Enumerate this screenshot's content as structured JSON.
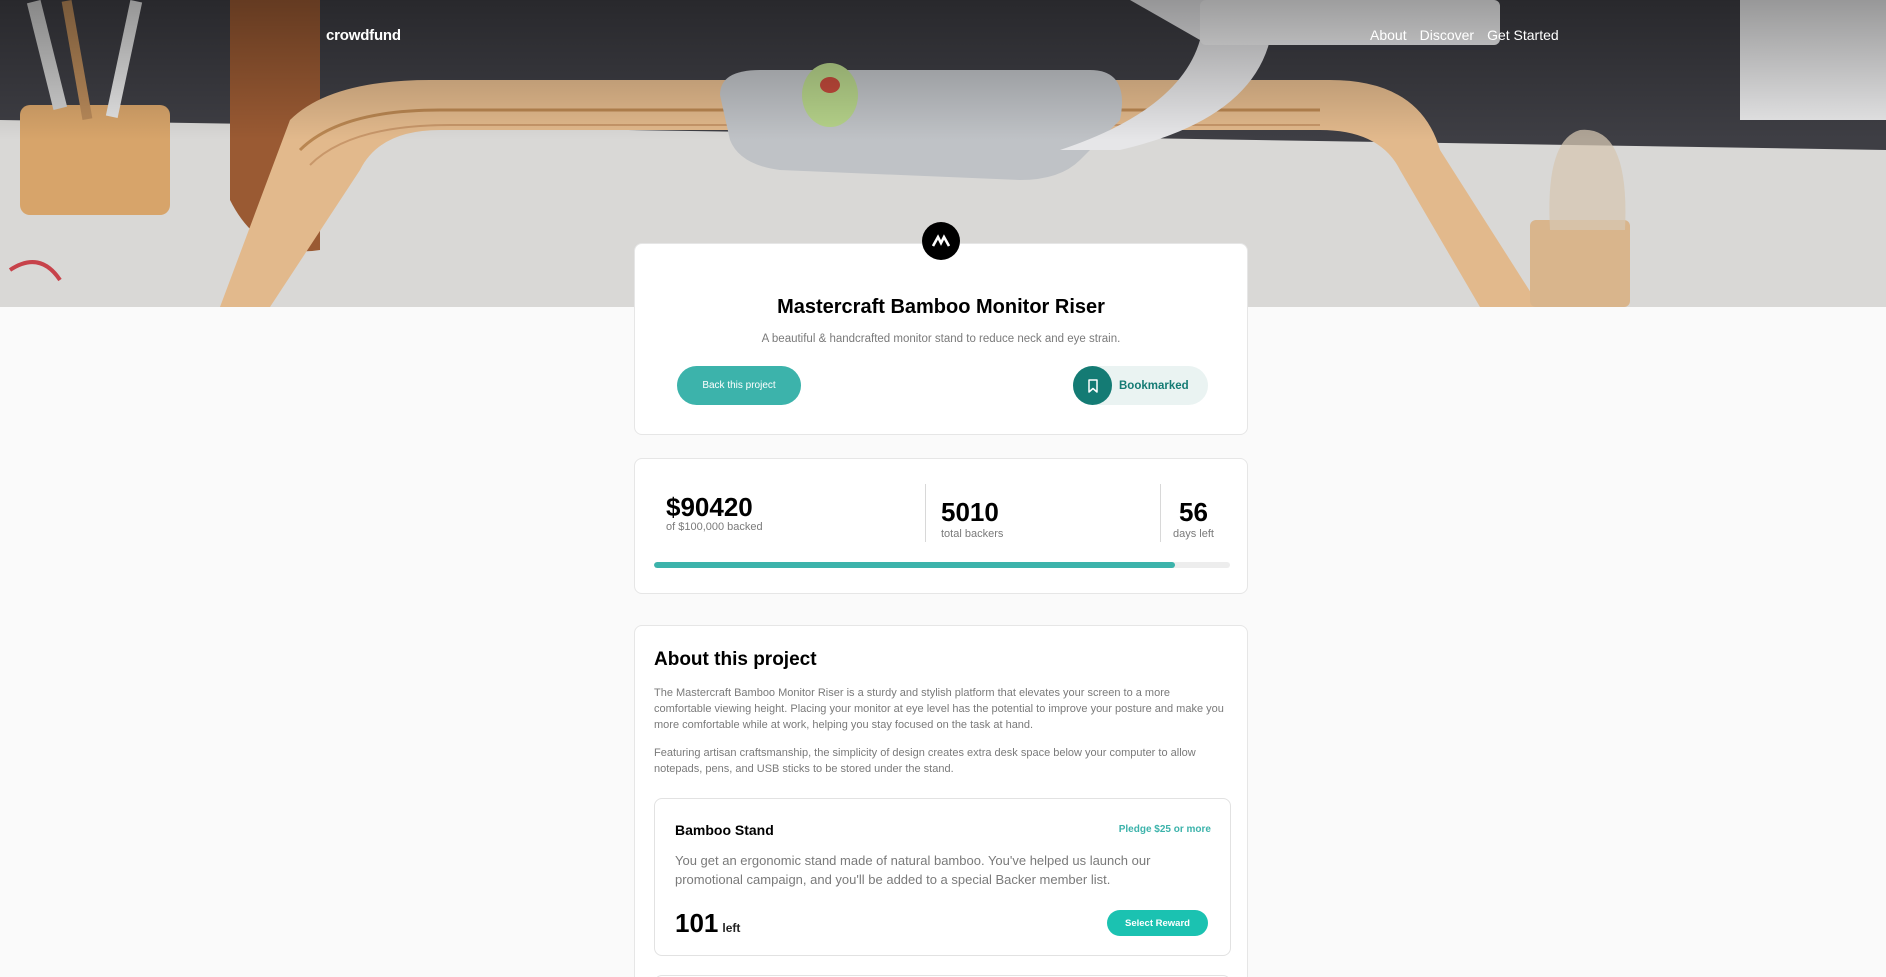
{
  "brand": {
    "logo": "crowdfund",
    "badge_icon": "mastercraft-logo-icon"
  },
  "nav": [
    {
      "label": "About"
    },
    {
      "label": "Discover"
    },
    {
      "label": "Get Started"
    }
  ],
  "project": {
    "title": "Mastercraft Bamboo Monitor Riser",
    "subtitle": "A beautiful & handcrafted monitor stand to reduce neck and eye strain.",
    "back_label": "Back this project",
    "bookmark_label": "Bookmarked",
    "bookmark_icon": "bookmark-icon"
  },
  "stats": {
    "backed": "$90420",
    "backed_label": "of $100,000 backed",
    "backers": "5010",
    "backers_label": "total backers",
    "days": "56",
    "days_label": "days left",
    "progress_fraction": 0.904
  },
  "about": {
    "title": "About this project",
    "paragraphs": [
      "The Mastercraft Bamboo Monitor Riser is a sturdy and stylish platform that elevates your screen to a more comfortable viewing height. Placing your monitor at eye level has the potential to improve your posture and make you more comfortable while at work, helping you stay focused on the task at hand.",
      "Featuring artisan craftsmanship, the simplicity of design creates extra desk space below your computer to allow notepads, pens, and USB sticks to be stored under the stand."
    ]
  },
  "rewards": [
    {
      "name": "Bamboo Stand",
      "pledge": "Pledge $25 or more",
      "description": "You get an ergonomic stand made of natural bamboo. You've helped us launch our promotional campaign, and you'll be added to a special Backer member list.",
      "count": "101",
      "left_label": "left",
      "button_label": "Select Reward"
    }
  ],
  "colors": {
    "accent": "#3cb3ab",
    "accent_dark": "#147b74",
    "button_bright": "#1bc2b1",
    "text_muted": "#7a7a7a"
  }
}
